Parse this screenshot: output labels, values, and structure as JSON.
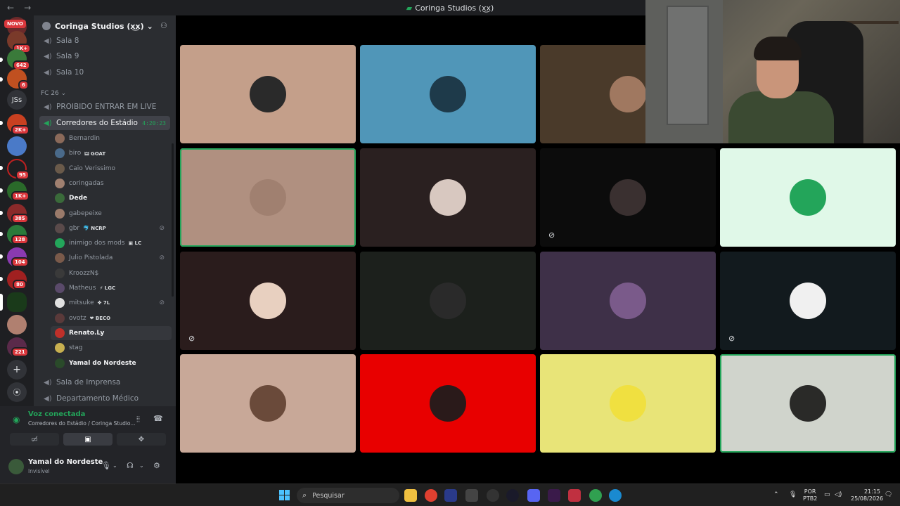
{
  "titlebar": {
    "back": "←",
    "forward": "→",
    "title": "Coringa Studios (x͜x)"
  },
  "rail": {
    "novo": "NOVO",
    "badges": [
      "1K+",
      "642",
      "6",
      "2K+",
      "95",
      "1K+",
      "385",
      "128",
      "104",
      "80",
      "221"
    ],
    "js_label": "JSs",
    "add": "+",
    "discover": "⦿"
  },
  "guild": {
    "name": "Coringa Studios (x͜x)",
    "chevron": "⌄"
  },
  "channels_top": [
    "Sala 8",
    "Sala 9",
    "Sala 10"
  ],
  "category": "FC 26",
  "channel_live": "PROIBIDO ENTRAR EM LIVE",
  "active_channel": {
    "name": "Corredores do Estádio",
    "timer": "4:20:23"
  },
  "members": [
    {
      "name": "Bernardin",
      "tag": "",
      "muted": false,
      "bold": false,
      "color": "#8b6a5a"
    },
    {
      "name": "biro",
      "tag": "🜲 GOAT",
      "muted": false,
      "bold": false,
      "color": "#4a6a8a"
    },
    {
      "name": "Caio Verissimo",
      "tag": "",
      "muted": false,
      "bold": false,
      "color": "#6a5a4a"
    },
    {
      "name": "coringadas",
      "tag": "",
      "muted": false,
      "bold": false,
      "color": "#a08070"
    },
    {
      "name": "Dede",
      "tag": "",
      "muted": false,
      "bold": true,
      "color": "#3a6a3a"
    },
    {
      "name": "gabepeixe",
      "tag": "",
      "muted": false,
      "bold": false,
      "color": "#9a7a6a"
    },
    {
      "name": "gbr",
      "tag": "🐬 NCRP",
      "muted": true,
      "bold": false,
      "color": "#5a4a4a"
    },
    {
      "name": "inimigo dos mods",
      "tag": "▣ LC",
      "muted": false,
      "bold": false,
      "color": "#23a55a"
    },
    {
      "name": "Julio Pistolada",
      "tag": "",
      "muted": true,
      "bold": false,
      "color": "#7a5a4a"
    },
    {
      "name": "KroozzN$",
      "tag": "",
      "muted": false,
      "bold": false,
      "color": "#3a3a3a"
    },
    {
      "name": "Matheus",
      "tag": "⚡ LGC",
      "muted": false,
      "bold": false,
      "color": "#5a4a6a"
    },
    {
      "name": "mitsuke",
      "tag": "✤ 7L",
      "muted": true,
      "bold": false,
      "color": "#e0e0e0"
    },
    {
      "name": "ovotz",
      "tag": "❤ BECO",
      "muted": false,
      "bold": false,
      "color": "#5a3a3a"
    },
    {
      "name": "Renato.Ly",
      "tag": "",
      "muted": false,
      "bold": true,
      "color": "#c0302a"
    },
    {
      "name": "stag",
      "tag": "",
      "muted": false,
      "bold": false,
      "color": "#c8b050"
    },
    {
      "name": "Yamal do Nordeste",
      "tag": "",
      "muted": false,
      "bold": true,
      "color": "#2a4a2a"
    }
  ],
  "channels_bottom": [
    "Sala de Imprensa",
    "Departamento Médico"
  ],
  "voice": {
    "status": "Voz conectada",
    "channel": "Corredores do Estádio / Coringa Studio..."
  },
  "user": {
    "name": "Yamal do Nordeste",
    "status": "Invisível"
  },
  "tiles": [
    {
      "bg": "#c49f8a",
      "avatar": "#2a2a2a",
      "muted": false,
      "speaking": false
    },
    {
      "bg": "#5096b8",
      "avatar": "#1e3a4a",
      "muted": false,
      "speaking": false
    },
    {
      "bg": "#4a3a2a",
      "avatar": "#a07860",
      "muted": false,
      "speaking": false
    },
    {
      "bg": "#b09080",
      "avatar": "#a08070",
      "muted": false,
      "speaking": true
    },
    {
      "bg": "#2a2020",
      "avatar": "#d8c8c0",
      "muted": false,
      "speaking": false
    },
    {
      "bg": "#0c0c0c",
      "avatar": "#3a3030",
      "muted": true,
      "speaking": false
    },
    {
      "bg": "#e0f8e8",
      "avatar": "#23a55a",
      "muted": false,
      "speaking": false
    },
    {
      "bg": "#2a1c1c",
      "avatar": "#e8d0c0",
      "muted": true,
      "speaking": false
    },
    {
      "bg": "#1c201c",
      "avatar": "#2a2a2a",
      "muted": false,
      "speaking": false
    },
    {
      "bg": "#3e3048",
      "avatar": "#7a5a8a",
      "muted": false,
      "speaking": false
    },
    {
      "bg": "#121a1e",
      "avatar": "#f0f0f0",
      "muted": true,
      "speaking": false
    },
    {
      "bg": "#c8a898",
      "avatar": "#6a4a3a",
      "muted": false,
      "speaking": false
    },
    {
      "bg": "#e80000",
      "avatar": "#2a1a1a",
      "muted": false,
      "speaking": false
    },
    {
      "bg": "#e8e478",
      "avatar": "#f0e040",
      "muted": false,
      "speaking": false
    },
    {
      "bg": "#d0d4cc",
      "avatar": "#2a2a28",
      "muted": false,
      "speaking": true
    }
  ],
  "taskbar": {
    "search_placeholder": "Pesquisar",
    "lang": "POR",
    "layout": "PTB2",
    "time": "21:15",
    "date": "25/08/2026"
  }
}
